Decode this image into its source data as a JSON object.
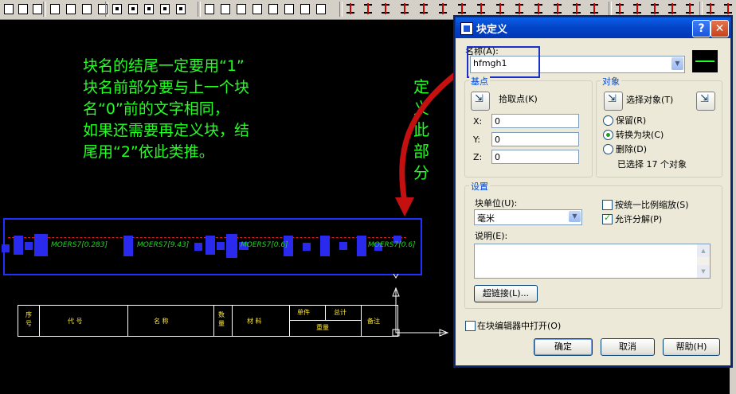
{
  "annotation": {
    "lines": [
      "块名的结尾一定要用“1”",
      "块名前部分要与上一个块",
      "名“0”前的文字相同，",
      "如果还需要再定义块，结",
      "尾用“2”依此类推。"
    ],
    "vertical": [
      "定",
      "义",
      "此",
      "部",
      "分"
    ]
  },
  "drawing": {
    "part_labels": [
      "MOERS7[0.283]",
      "MOERS7[9.43]",
      "MOERS7[0.6]",
      "MOERS7[0.6]"
    ],
    "title_block": {
      "columns": [
        "序号",
        "代 号",
        "名 称",
        "数量",
        "材 料",
        "单件",
        "总计",
        "重量",
        "备注"
      ]
    }
  },
  "dialog": {
    "title": "块定义",
    "help_btn": "?",
    "close_btn": "✕",
    "name_label": "名称(A):",
    "name_value": "hfmgh1",
    "basepoint": {
      "title": "基点",
      "pick_label": "拾取点(K)",
      "x_label": "X:",
      "x_value": "0",
      "y_label": "Y:",
      "y_value": "0",
      "z_label": "Z:",
      "z_value": "0"
    },
    "objects": {
      "title": "对象",
      "select_label": "选择对象(T)",
      "retain": "保留(R)",
      "convert": "转换为块(C)",
      "delete": "删除(D)",
      "status": "已选择 17 个对象",
      "selected_option": "convert"
    },
    "settings": {
      "title": "设置",
      "units_label": "块单位(U):",
      "units_value": "毫米",
      "scale_uniform": "按统一比例缩放(S)",
      "allow_explode": "允许分解(P)",
      "desc_label": "说明(E):",
      "hyperlink": "超链接(L)..."
    },
    "open_in_editor": "在块编辑器中打开(O)",
    "ok": "确定",
    "cancel": "取消",
    "help": "帮助(H)"
  },
  "colors": {
    "annotation": "#22ff22",
    "highlight": "#2230ff",
    "titlebar": "#0443c6"
  }
}
